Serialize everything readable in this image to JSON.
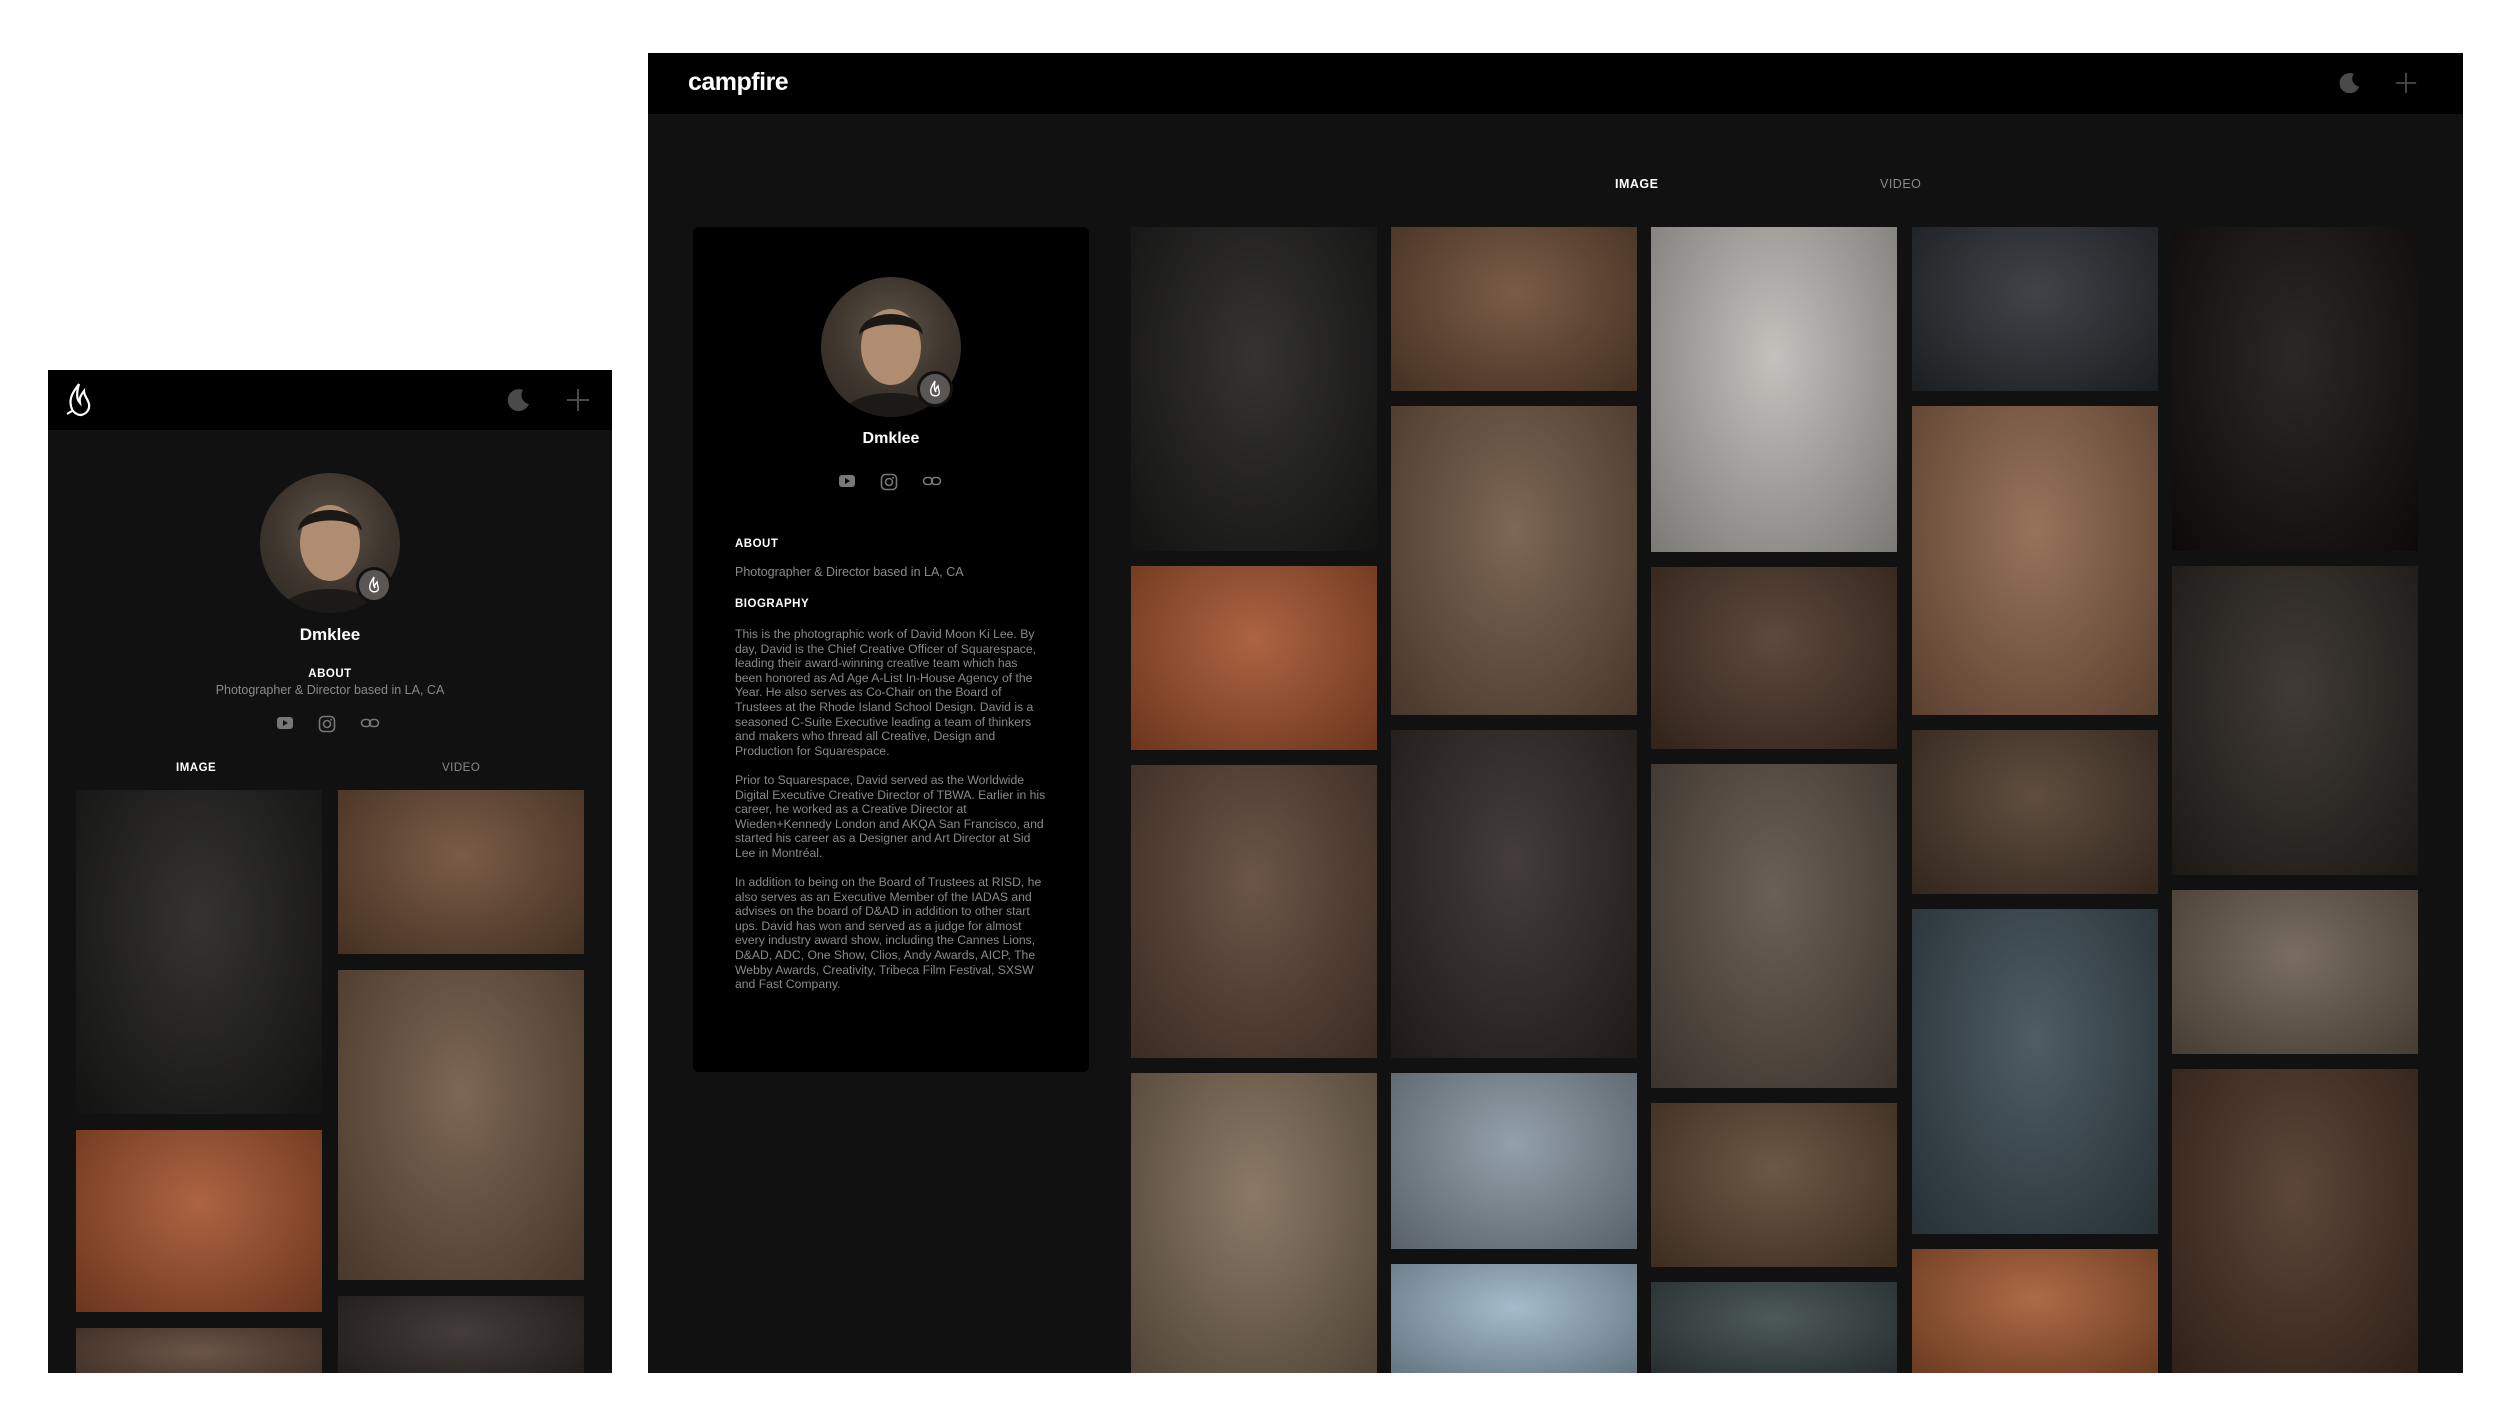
{
  "app": {
    "logo_text": "campfire"
  },
  "profile": {
    "name": "Dmklee",
    "about_heading": "ABOUT",
    "about_text": "Photographer & Director based in LA, CA",
    "bio_heading": "BIOGRAPHY",
    "bio_paragraphs": [
      "This is the photographic work of David Moon Ki Lee. By day, David is the Chief Creative Officer of Squarespace, leading their award-winning creative team which has been honored as Ad Age A-List In-House Agency of the Year. He also serves as Co-Chair on the Board of Trustees at the Rhode Island School Design. David is a seasoned C-Suite Executive leading a team of thinkers and makers who thread all Creative, Design and Production for Squarespace.",
      "Prior to Squarespace, David served as the Worldwide Digital Executive Creative Director of TBWA. Earlier in his career, he worked as a Creative Director at Wieden+Kennedy London and AKQA San Francisco, and started his career as a Designer and Art Director at Sid Lee in Montréal.",
      "In addition to being on the Board of Trustees at RISD, he also serves as an Executive Member of the IADAS and advises on the board of D&AD in addition to other start ups. David has won and served as a judge for almost every industry award show, including the Cannes Lions, D&AD, ADC, One Show, Clios, Andy Awards, AICP, The Webby Awards, Creativity, Tribeca Film Festival, SXSW and Fast Company."
    ],
    "social_icons": [
      "youtube-icon",
      "instagram-icon",
      "link-icon"
    ]
  },
  "tabs": [
    {
      "label": "IMAGE",
      "active": true
    },
    {
      "label": "VIDEO",
      "active": false
    }
  ],
  "icons": {
    "theme_toggle": "moon-icon",
    "add": "plus-icon",
    "logo": "flame-icon"
  },
  "colors": {
    "background": "#111111",
    "bar": "#000000",
    "text": "#ffffff",
    "muted": "#8a8a8a"
  },
  "photos": [
    {
      "subject": "man-in-black-hat",
      "color": "#1d1c1b"
    },
    {
      "subject": "spice-bowls",
      "color": "#6a4a33"
    },
    {
      "subject": "man-glasses-gray-beard",
      "color": "#bdbab5"
    },
    {
      "subject": "car-interior-dark",
      "color": "#2a2e33"
    },
    {
      "subject": "dark-doorway",
      "color": "#140f0e"
    },
    {
      "subject": "bald-man-glasses",
      "color": "#6e5541"
    },
    {
      "subject": "elderly-man-turban",
      "color": "#8b6348"
    },
    {
      "subject": "slot-canyon",
      "color": "#a4522d"
    },
    {
      "subject": "woman-in-alley",
      "color": "#4b3527"
    },
    {
      "subject": "man-behind-door",
      "color": "#2b2520"
    },
    {
      "subject": "woman-profile",
      "color": "#5a4233"
    },
    {
      "subject": "man-portrait-dark",
      "color": "#2f2724"
    },
    {
      "subject": "rickshaw-driver",
      "color": "#5a4e44"
    },
    {
      "subject": "steering-wheel-hand",
      "color": "#4d3a2a"
    },
    {
      "subject": "child-in-hood",
      "color": "#3b4a52"
    },
    {
      "subject": "man-red-cap-window",
      "color": "#6a5d50"
    },
    {
      "subject": "hindi-signboard",
      "color": "#7d6a55"
    },
    {
      "subject": "building-facade",
      "color": "#8895a0"
    },
    {
      "subject": "sky-spire",
      "color": "#9ab4c6"
    },
    {
      "subject": "steering-wheel-road",
      "color": "#5c4530"
    },
    {
      "subject": "hooded-figure",
      "color": "#3a4648"
    },
    {
      "subject": "orange-desert",
      "color": "#a45a32"
    },
    {
      "subject": "long-hair-man",
      "color": "#4a3223"
    }
  ]
}
